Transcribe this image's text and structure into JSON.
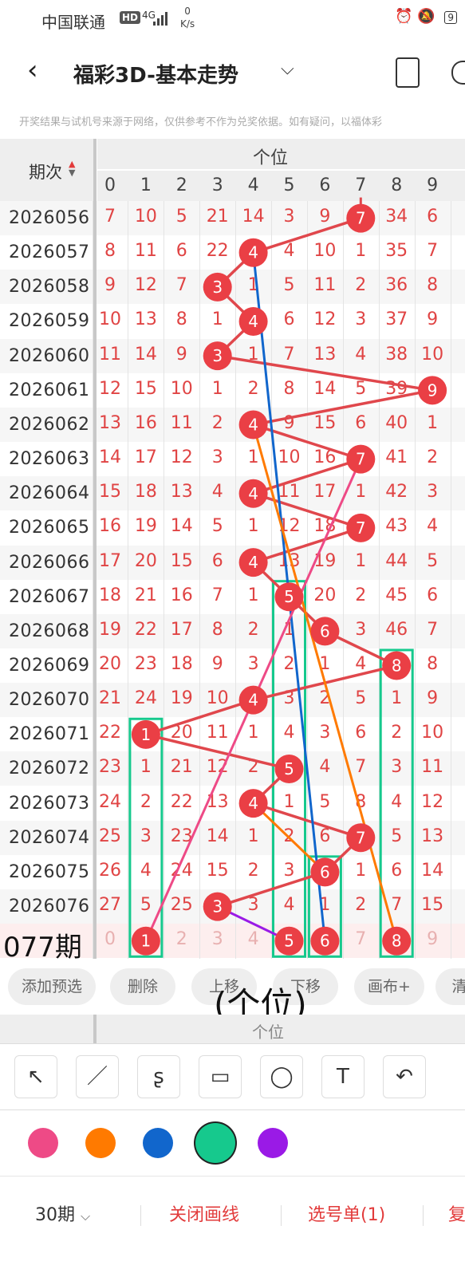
{
  "status_bar": {
    "carrier": "中国联通",
    "hd": "HD",
    "network": "4G",
    "speed_value": "0",
    "speed_unit": "K/s",
    "battery": "9"
  },
  "header": {
    "back_icon": "chevron-left-icon",
    "title": "福彩3D-基本走势",
    "dropdown_icon": "chevron-down-icon"
  },
  "notice": "开奖结果与试机号来源于网络，仅供参考不作为兑奖依据。如有疑问，以福体彩",
  "table": {
    "period_header": "期次",
    "position_header": "个位",
    "digits": [
      "0",
      "1",
      "2",
      "3",
      "4",
      "5",
      "6",
      "7",
      "8",
      "9"
    ],
    "rows": [
      {
        "period": "2026056",
        "values": [
          "7",
          "10",
          "5",
          "21",
          "14",
          "3",
          "9",
          "7",
          "34",
          "6"
        ],
        "winner": 7
      },
      {
        "period": "2026057",
        "values": [
          "8",
          "11",
          "6",
          "22",
          "4",
          "4",
          "10",
          "1",
          "35",
          "7"
        ],
        "winner": 4
      },
      {
        "period": "2026058",
        "values": [
          "9",
          "12",
          "7",
          "3",
          "1",
          "5",
          "11",
          "2",
          "36",
          "8"
        ],
        "winner": 3
      },
      {
        "period": "2026059",
        "values": [
          "10",
          "13",
          "8",
          "1",
          "4",
          "6",
          "12",
          "3",
          "37",
          "9"
        ],
        "winner": 4
      },
      {
        "period": "2026060",
        "values": [
          "11",
          "14",
          "9",
          "3",
          "1",
          "7",
          "13",
          "4",
          "38",
          "10"
        ],
        "winner": 3
      },
      {
        "period": "2026061",
        "values": [
          "12",
          "15",
          "10",
          "1",
          "2",
          "8",
          "14",
          "5",
          "39",
          "9"
        ],
        "winner": 9
      },
      {
        "period": "2026062",
        "values": [
          "13",
          "16",
          "11",
          "2",
          "4",
          "9",
          "15",
          "6",
          "40",
          "1"
        ],
        "winner": 4
      },
      {
        "period": "2026063",
        "values": [
          "14",
          "17",
          "12",
          "3",
          "1",
          "10",
          "16",
          "7",
          "41",
          "2"
        ],
        "winner": 7
      },
      {
        "period": "2026064",
        "values": [
          "15",
          "18",
          "13",
          "4",
          "4",
          "11",
          "17",
          "1",
          "42",
          "3"
        ],
        "winner": 4
      },
      {
        "period": "2026065",
        "values": [
          "16",
          "19",
          "14",
          "5",
          "1",
          "12",
          "18",
          "7",
          "43",
          "4"
        ],
        "winner": 7
      },
      {
        "period": "2026066",
        "values": [
          "17",
          "20",
          "15",
          "6",
          "4",
          "13",
          "19",
          "1",
          "44",
          "5"
        ],
        "winner": 4
      },
      {
        "period": "2026067",
        "values": [
          "18",
          "21",
          "16",
          "7",
          "1",
          "5",
          "20",
          "2",
          "45",
          "6"
        ],
        "winner": 5
      },
      {
        "period": "2026068",
        "values": [
          "19",
          "22",
          "17",
          "8",
          "2",
          "1",
          "6",
          "3",
          "46",
          "7"
        ],
        "winner": 6
      },
      {
        "period": "2026069",
        "values": [
          "20",
          "23",
          "18",
          "9",
          "3",
          "2",
          "1",
          "4",
          "8",
          "8"
        ],
        "winner": 8
      },
      {
        "period": "2026070",
        "values": [
          "21",
          "24",
          "19",
          "10",
          "4",
          "3",
          "2",
          "5",
          "1",
          "9"
        ],
        "winner": 4
      },
      {
        "period": "2026071",
        "values": [
          "22",
          "1",
          "20",
          "11",
          "1",
          "4",
          "3",
          "6",
          "2",
          "10"
        ],
        "winner": 1
      },
      {
        "period": "2026072",
        "values": [
          "23",
          "1",
          "21",
          "12",
          "2",
          "5",
          "4",
          "7",
          "3",
          "11"
        ],
        "winner": 5
      },
      {
        "period": "2026073",
        "values": [
          "24",
          "2",
          "22",
          "13",
          "4",
          "1",
          "5",
          "8",
          "4",
          "12"
        ],
        "winner": 4
      },
      {
        "period": "2026074",
        "values": [
          "25",
          "3",
          "23",
          "14",
          "1",
          "2",
          "6",
          "7",
          "5",
          "13"
        ],
        "winner": 7
      },
      {
        "period": "2026075",
        "values": [
          "26",
          "4",
          "24",
          "15",
          "2",
          "3",
          "6",
          "1",
          "6",
          "14"
        ],
        "winner": 6
      },
      {
        "period": "2026076",
        "values": [
          "27",
          "5",
          "25",
          "3",
          "3",
          "4",
          "1",
          "2",
          "7",
          "15"
        ],
        "winner": 3
      }
    ],
    "prediction_row": {
      "label": "077期",
      "values": [
        "0",
        "1",
        "2",
        "3",
        "4",
        "5",
        "6",
        "7",
        "8",
        "9"
      ],
      "picks": [
        1,
        5,
        6,
        8
      ]
    }
  },
  "actions": [
    "添加预选",
    "删除",
    "上移",
    "下移",
    "画布+",
    "清"
  ],
  "overlay_note": "(个位)",
  "strip_label": "个位",
  "tools": [
    {
      "icon": "arrow-tool-icon",
      "glyph": "↖"
    },
    {
      "icon": "line-tool-icon",
      "glyph": "／"
    },
    {
      "icon": "curve-tool-icon",
      "glyph": "ʂ"
    },
    {
      "icon": "rectangle-tool-icon",
      "glyph": "▭"
    },
    {
      "icon": "circle-tool-icon",
      "glyph": "◯"
    },
    {
      "icon": "text-tool-icon",
      "glyph": "T"
    },
    {
      "icon": "undo-tool-icon",
      "glyph": "↶"
    }
  ],
  "palette": [
    "#ee4a86",
    "#ff7a00",
    "#1166cc",
    "#16c98d",
    "#9a1ae6"
  ],
  "bottom": {
    "periods": "30期",
    "close_lines": "关闭画线",
    "selection": "选号单(1)",
    "more": "复"
  }
}
